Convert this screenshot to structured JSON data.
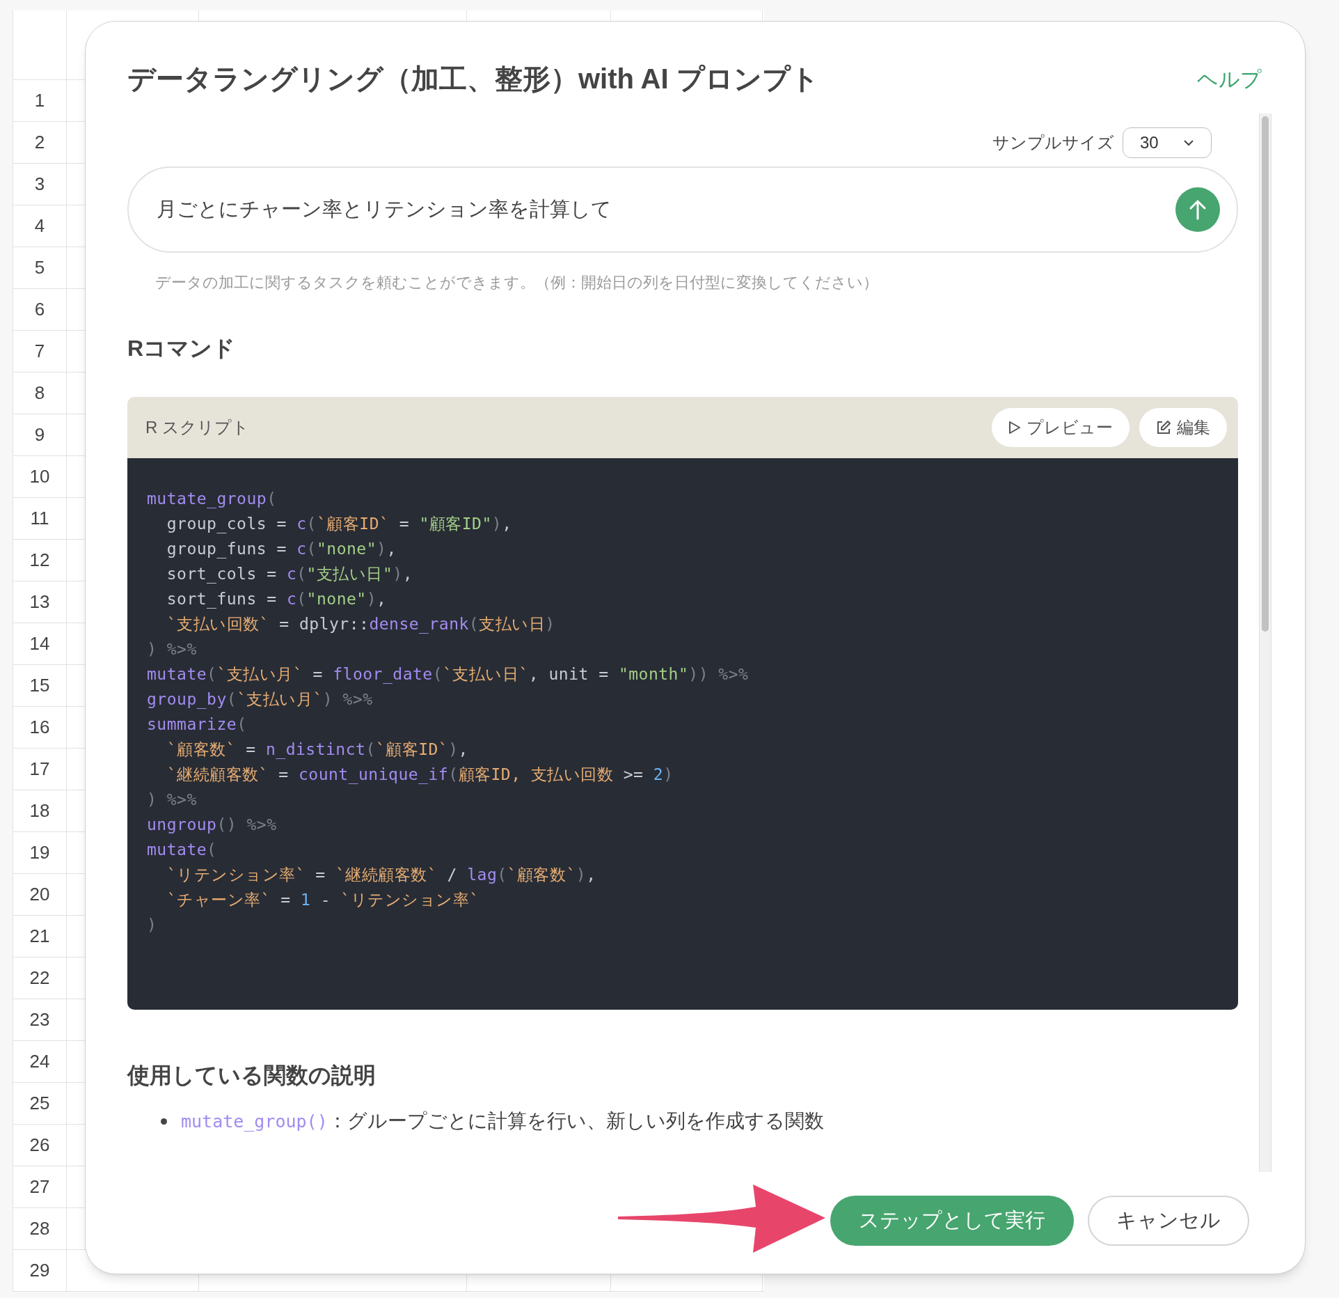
{
  "sheet": {
    "row_numbers": [
      "1",
      "2",
      "3",
      "4",
      "5",
      "6",
      "7",
      "8",
      "9",
      "10",
      "11",
      "12",
      "13",
      "14",
      "15",
      "16",
      "17",
      "18",
      "19",
      "20",
      "21",
      "22",
      "23",
      "24",
      "25",
      "26",
      "27",
      "28",
      "29"
    ]
  },
  "dialog": {
    "title": "データラングリング（加工、整形）with AI プロンプト",
    "help_link": "ヘルプ",
    "sample_size": {
      "label": "サンプルサイズ",
      "value": "30"
    },
    "prompt": {
      "value": "月ごとにチャーン率とリテンション率を計算して",
      "hint": "データの加工に関するタスクを頼むことができます。（例：開始日の列を日付型に変換してください）"
    },
    "command_heading": "Rコマンド",
    "script": {
      "title": "R スクリプト",
      "buttons": [
        {
          "kind": "preview",
          "label": "プレビュー"
        },
        {
          "kind": "edit",
          "label": "編集"
        }
      ],
      "lines": [
        [
          {
            "kind": "fn",
            "text": "mutate_group"
          },
          {
            "kind": "punct",
            "text": "("
          }
        ],
        [
          {
            "kind": "plain",
            "text": "  group_cols = "
          },
          {
            "kind": "fn",
            "text": "c"
          },
          {
            "kind": "punct",
            "text": "("
          },
          {
            "kind": "name",
            "text": "`顧客ID`"
          },
          {
            "kind": "plain",
            "text": " = "
          },
          {
            "kind": "str",
            "text": "\"顧客ID\""
          },
          {
            "kind": "punct",
            "text": ")"
          },
          {
            "kind": "plain",
            "text": ","
          }
        ],
        [
          {
            "kind": "plain",
            "text": "  group_funs = "
          },
          {
            "kind": "fn",
            "text": "c"
          },
          {
            "kind": "punct",
            "text": "("
          },
          {
            "kind": "str",
            "text": "\"none\""
          },
          {
            "kind": "punct",
            "text": ")"
          },
          {
            "kind": "plain",
            "text": ","
          }
        ],
        [
          {
            "kind": "plain",
            "text": "  sort_cols = "
          },
          {
            "kind": "fn",
            "text": "c"
          },
          {
            "kind": "punct",
            "text": "("
          },
          {
            "kind": "str",
            "text": "\"支払い日\""
          },
          {
            "kind": "punct",
            "text": ")"
          },
          {
            "kind": "plain",
            "text": ","
          }
        ],
        [
          {
            "kind": "plain",
            "text": "  sort_funs = "
          },
          {
            "kind": "fn",
            "text": "c"
          },
          {
            "kind": "punct",
            "text": "("
          },
          {
            "kind": "str",
            "text": "\"none\""
          },
          {
            "kind": "punct",
            "text": ")"
          },
          {
            "kind": "plain",
            "text": ","
          }
        ],
        [
          {
            "kind": "name",
            "text": "  `支払い回数`"
          },
          {
            "kind": "plain",
            "text": " = dplyr::"
          },
          {
            "kind": "fn",
            "text": "dense_rank"
          },
          {
            "kind": "punct",
            "text": "("
          },
          {
            "kind": "name",
            "text": "支払い日"
          },
          {
            "kind": "punct",
            "text": ")"
          }
        ],
        [
          {
            "kind": "punct",
            "text": ") %>%"
          }
        ],
        [
          {
            "kind": "fn",
            "text": "mutate"
          },
          {
            "kind": "punct",
            "text": "("
          },
          {
            "kind": "name",
            "text": "`支払い月`"
          },
          {
            "kind": "plain",
            "text": " = "
          },
          {
            "kind": "fn",
            "text": "floor_date"
          },
          {
            "kind": "punct",
            "text": "("
          },
          {
            "kind": "name",
            "text": "`支払い日`"
          },
          {
            "kind": "plain",
            "text": ", unit = "
          },
          {
            "kind": "str",
            "text": "\"month\""
          },
          {
            "kind": "punct",
            "text": ")) %>%"
          }
        ],
        [
          {
            "kind": "fn",
            "text": "group_by"
          },
          {
            "kind": "punct",
            "text": "("
          },
          {
            "kind": "name",
            "text": "`支払い月`"
          },
          {
            "kind": "punct",
            "text": ") %>%"
          }
        ],
        [
          {
            "kind": "fn",
            "text": "summarize"
          },
          {
            "kind": "punct",
            "text": "("
          }
        ],
        [
          {
            "kind": "name",
            "text": "  `顧客数`"
          },
          {
            "kind": "plain",
            "text": " = "
          },
          {
            "kind": "fn",
            "text": "n_distinct"
          },
          {
            "kind": "punct",
            "text": "("
          },
          {
            "kind": "name",
            "text": "`顧客ID`"
          },
          {
            "kind": "punct",
            "text": ")"
          },
          {
            "kind": "plain",
            "text": ","
          }
        ],
        [
          {
            "kind": "name",
            "text": "  `継続顧客数`"
          },
          {
            "kind": "plain",
            "text": " = "
          },
          {
            "kind": "fn",
            "text": "count_unique_if"
          },
          {
            "kind": "punct",
            "text": "("
          },
          {
            "kind": "name",
            "text": "顧客ID, 支払い回数"
          },
          {
            "kind": "plain",
            "text": " >= "
          },
          {
            "kind": "num",
            "text": "2"
          },
          {
            "kind": "punct",
            "text": ")"
          }
        ],
        [
          {
            "kind": "punct",
            "text": ") %>%"
          }
        ],
        [
          {
            "kind": "fn",
            "text": "ungroup"
          },
          {
            "kind": "punct",
            "text": "() %>%"
          }
        ],
        [
          {
            "kind": "fn",
            "text": "mutate"
          },
          {
            "kind": "punct",
            "text": "("
          }
        ],
        [
          {
            "kind": "name",
            "text": "  `リテンション率`"
          },
          {
            "kind": "plain",
            "text": " = "
          },
          {
            "kind": "name",
            "text": "`継続顧客数`"
          },
          {
            "kind": "plain",
            "text": " / "
          },
          {
            "kind": "fn",
            "text": "lag"
          },
          {
            "kind": "punct",
            "text": "("
          },
          {
            "kind": "name",
            "text": "`顧客数`"
          },
          {
            "kind": "punct",
            "text": ")"
          },
          {
            "kind": "plain",
            "text": ","
          }
        ],
        [
          {
            "kind": "name",
            "text": "  `チャーン率`"
          },
          {
            "kind": "plain",
            "text": " = "
          },
          {
            "kind": "num",
            "text": "1"
          },
          {
            "kind": "plain",
            "text": " - "
          },
          {
            "kind": "name",
            "text": "`リテンション率`"
          }
        ],
        [
          {
            "kind": "punct",
            "text": ")"
          }
        ]
      ]
    },
    "functions_heading": "使用している関数の説明",
    "functions": [
      {
        "name": "mutate_group()",
        "text": "：グループごとに計算を行い、新しい列を作成する関数"
      }
    ],
    "buttons": [
      {
        "kind": "primary",
        "label": "ステップとして実行"
      },
      {
        "kind": "secondary",
        "label": "キャンセル"
      }
    ]
  }
}
